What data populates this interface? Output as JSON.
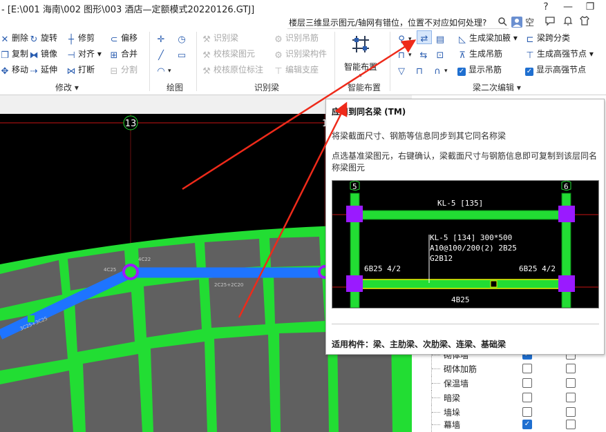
{
  "window": {
    "title": "- [E:\\001 海南\\002 图形\\003 酒店—定额模式20220126.GTJ]",
    "minimize": "—",
    "restore": "❐",
    "help_icon": "question-icon",
    "user_initial": "空"
  },
  "search": {
    "text": "楼层三维显示图元/轴网有错位，位置不对应如何处理?"
  },
  "ribbon": {
    "modify": {
      "label": "修改 ▾",
      "items": [
        "删除",
        "旋转",
        "修剪",
        "偏移",
        "复制",
        "镜像",
        "对齐 ▾",
        "合并",
        "移动",
        "延伸",
        "打断",
        "分割"
      ]
    },
    "draw": {
      "label": "绘图"
    },
    "identify_beam": {
      "label": "识别梁",
      "items": [
        "识别梁",
        "识别吊筋",
        "校核梁图元",
        "识别梁构件",
        "校核原位标注",
        "编辑支座"
      ]
    },
    "smart_layout": {
      "button": "智能布置",
      "label": "智能布置"
    },
    "beam_secondary": {
      "label": "梁二次编辑 ▾",
      "items": [
        "生成梁加腋 ▾",
        "梁跨分类",
        "生成吊筋",
        "生成高强节点 ▾",
        "显示吊筋",
        "显示高强节点"
      ]
    }
  },
  "canvas": {
    "axis_left": "13",
    "axis_right": "1",
    "beam_labels": [
      "2C25+2C20",
      "3C25+3C25",
      "4C25",
      "4C22"
    ]
  },
  "tooltip": {
    "title": "应用到同名梁 (TM)",
    "desc1": "将梁截面尺寸、钢筋等信息同步到其它同名称梁",
    "desc2": "点选基准梁图元，右键确认，梁截面尺寸与钢筋信息即可复制到该层同名称梁图元",
    "figure": {
      "axis_left": "5",
      "axis_right": "6",
      "top_beam": "KL-5 [135]",
      "note_line1": "KL-5 [134] 300*500",
      "note_line2": "A10@100/200(2) 2B25",
      "note_line3": "G2B12",
      "left_label": "6B25 4/2",
      "right_label": "6B25 4/2",
      "bottom_label": "4B25"
    },
    "footer": "适用构件：梁、主肋梁、次肋梁、连梁、基础梁"
  },
  "table": {
    "rows": [
      {
        "name": "砌体墙",
        "c1": true,
        "c2": false
      },
      {
        "name": "砌体加筋",
        "c1": false,
        "c2": false
      },
      {
        "name": "保温墙",
        "c1": false,
        "c2": false
      },
      {
        "name": "暗梁",
        "c1": false,
        "c2": false
      },
      {
        "name": "墙垛",
        "c1": false,
        "c2": false
      },
      {
        "name": "幕墙",
        "c1": true,
        "c2": false
      }
    ]
  },
  "colors": {
    "beam_blue": "#1e74ff",
    "beam_green": "#22dd33",
    "slab_gray": "#606060",
    "axis_red": "#c81414",
    "arrow_red": "#ee2a1a",
    "column_purple": "#9a1aff",
    "check_blue": "#1f6fd0"
  }
}
